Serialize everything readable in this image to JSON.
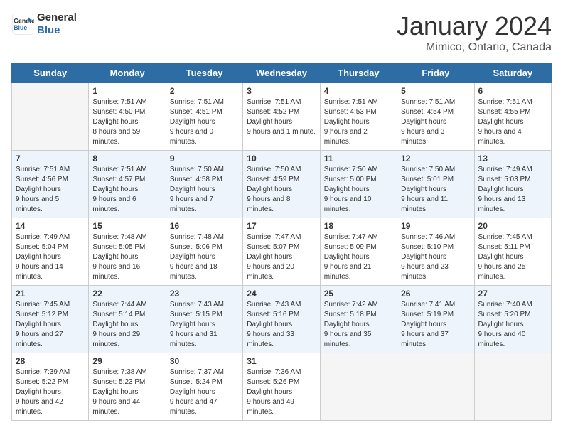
{
  "logo": {
    "line1": "General",
    "line2": "Blue"
  },
  "title": "January 2024",
  "subtitle": "Mimico, Ontario, Canada",
  "weekdays": [
    "Sunday",
    "Monday",
    "Tuesday",
    "Wednesday",
    "Thursday",
    "Friday",
    "Saturday"
  ],
  "weeks": [
    [
      {
        "day": "",
        "empty": true
      },
      {
        "day": "1",
        "sunrise": "7:51 AM",
        "sunset": "4:50 PM",
        "daylight": "8 hours and 59 minutes."
      },
      {
        "day": "2",
        "sunrise": "7:51 AM",
        "sunset": "4:51 PM",
        "daylight": "9 hours and 0 minutes."
      },
      {
        "day": "3",
        "sunrise": "7:51 AM",
        "sunset": "4:52 PM",
        "daylight": "9 hours and 1 minute."
      },
      {
        "day": "4",
        "sunrise": "7:51 AM",
        "sunset": "4:53 PM",
        "daylight": "9 hours and 2 minutes."
      },
      {
        "day": "5",
        "sunrise": "7:51 AM",
        "sunset": "4:54 PM",
        "daylight": "9 hours and 3 minutes."
      },
      {
        "day": "6",
        "sunrise": "7:51 AM",
        "sunset": "4:55 PM",
        "daylight": "9 hours and 4 minutes."
      }
    ],
    [
      {
        "day": "7",
        "sunrise": "7:51 AM",
        "sunset": "4:56 PM",
        "daylight": "9 hours and 5 minutes."
      },
      {
        "day": "8",
        "sunrise": "7:51 AM",
        "sunset": "4:57 PM",
        "daylight": "9 hours and 6 minutes."
      },
      {
        "day": "9",
        "sunrise": "7:50 AM",
        "sunset": "4:58 PM",
        "daylight": "9 hours and 7 minutes."
      },
      {
        "day": "10",
        "sunrise": "7:50 AM",
        "sunset": "4:59 PM",
        "daylight": "9 hours and 8 minutes."
      },
      {
        "day": "11",
        "sunrise": "7:50 AM",
        "sunset": "5:00 PM",
        "daylight": "9 hours and 10 minutes."
      },
      {
        "day": "12",
        "sunrise": "7:50 AM",
        "sunset": "5:01 PM",
        "daylight": "9 hours and 11 minutes."
      },
      {
        "day": "13",
        "sunrise": "7:49 AM",
        "sunset": "5:03 PM",
        "daylight": "9 hours and 13 minutes."
      }
    ],
    [
      {
        "day": "14",
        "sunrise": "7:49 AM",
        "sunset": "5:04 PM",
        "daylight": "9 hours and 14 minutes."
      },
      {
        "day": "15",
        "sunrise": "7:48 AM",
        "sunset": "5:05 PM",
        "daylight": "9 hours and 16 minutes."
      },
      {
        "day": "16",
        "sunrise": "7:48 AM",
        "sunset": "5:06 PM",
        "daylight": "9 hours and 18 minutes."
      },
      {
        "day": "17",
        "sunrise": "7:47 AM",
        "sunset": "5:07 PM",
        "daylight": "9 hours and 20 minutes."
      },
      {
        "day": "18",
        "sunrise": "7:47 AM",
        "sunset": "5:09 PM",
        "daylight": "9 hours and 21 minutes."
      },
      {
        "day": "19",
        "sunrise": "7:46 AM",
        "sunset": "5:10 PM",
        "daylight": "9 hours and 23 minutes."
      },
      {
        "day": "20",
        "sunrise": "7:45 AM",
        "sunset": "5:11 PM",
        "daylight": "9 hours and 25 minutes."
      }
    ],
    [
      {
        "day": "21",
        "sunrise": "7:45 AM",
        "sunset": "5:12 PM",
        "daylight": "9 hours and 27 minutes."
      },
      {
        "day": "22",
        "sunrise": "7:44 AM",
        "sunset": "5:14 PM",
        "daylight": "9 hours and 29 minutes."
      },
      {
        "day": "23",
        "sunrise": "7:43 AM",
        "sunset": "5:15 PM",
        "daylight": "9 hours and 31 minutes."
      },
      {
        "day": "24",
        "sunrise": "7:43 AM",
        "sunset": "5:16 PM",
        "daylight": "9 hours and 33 minutes."
      },
      {
        "day": "25",
        "sunrise": "7:42 AM",
        "sunset": "5:18 PM",
        "daylight": "9 hours and 35 minutes."
      },
      {
        "day": "26",
        "sunrise": "7:41 AM",
        "sunset": "5:19 PM",
        "daylight": "9 hours and 37 minutes."
      },
      {
        "day": "27",
        "sunrise": "7:40 AM",
        "sunset": "5:20 PM",
        "daylight": "9 hours and 40 minutes."
      }
    ],
    [
      {
        "day": "28",
        "sunrise": "7:39 AM",
        "sunset": "5:22 PM",
        "daylight": "9 hours and 42 minutes."
      },
      {
        "day": "29",
        "sunrise": "7:38 AM",
        "sunset": "5:23 PM",
        "daylight": "9 hours and 44 minutes."
      },
      {
        "day": "30",
        "sunrise": "7:37 AM",
        "sunset": "5:24 PM",
        "daylight": "9 hours and 47 minutes."
      },
      {
        "day": "31",
        "sunrise": "7:36 AM",
        "sunset": "5:26 PM",
        "daylight": "9 hours and 49 minutes."
      },
      {
        "day": "",
        "empty": true
      },
      {
        "day": "",
        "empty": true
      },
      {
        "day": "",
        "empty": true
      }
    ]
  ]
}
